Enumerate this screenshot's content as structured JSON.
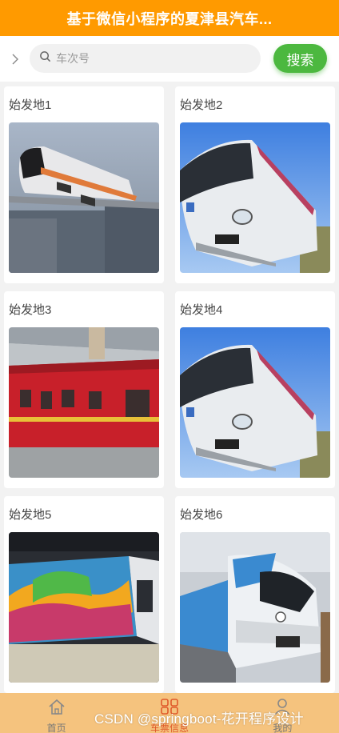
{
  "header": {
    "title": "基于微信小程序的夏津县汽车..."
  },
  "search": {
    "placeholder": "车次号",
    "value": "",
    "button_label": "搜索"
  },
  "cards": [
    {
      "title": "始发地1",
      "image": "monorail-train"
    },
    {
      "title": "始发地2",
      "image": "white-high-speed-train"
    },
    {
      "title": "始发地3",
      "image": "red-passenger-train"
    },
    {
      "title": "始发地4",
      "image": "white-high-speed-train"
    },
    {
      "title": "始发地5",
      "image": "colorful-metro-train"
    },
    {
      "title": "始发地6",
      "image": "blue-white-commuter-train"
    }
  ],
  "tabbar": {
    "items": [
      {
        "label": "首页",
        "icon": "home-icon"
      },
      {
        "label": "车票信息",
        "icon": "ticket-icon",
        "active": true
      },
      {
        "label": "我的",
        "icon": "user-icon"
      }
    ]
  },
  "watermark": "CSDN @springboot-花开程序设计",
  "colors": {
    "header": "#ff9a00",
    "button": "#4cb83f",
    "tabbar": "#f5c37e"
  }
}
